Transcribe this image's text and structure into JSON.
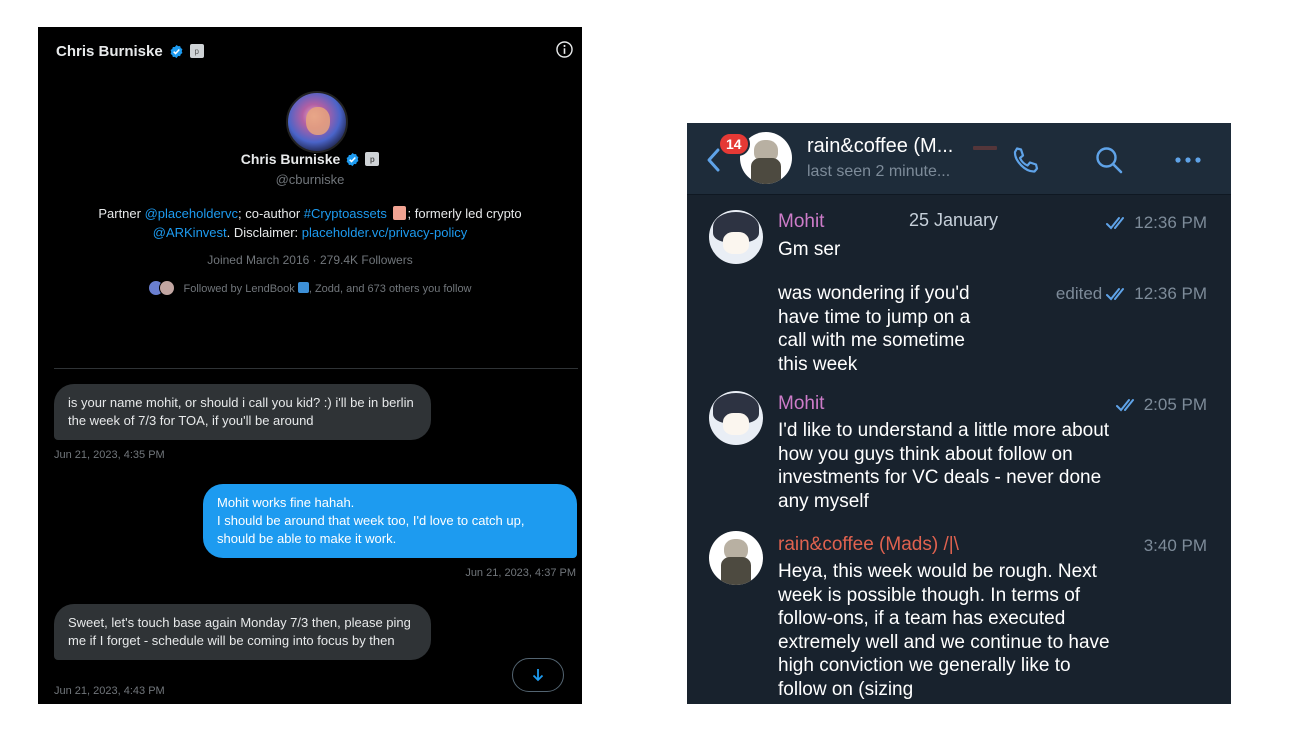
{
  "twitter": {
    "header_name": "Chris Burniske",
    "profile": {
      "name": "Chris Burniske",
      "handle": "@cburniske",
      "bio": {
        "t1": "Partner ",
        "l1": "@placeholdervc",
        "t2": "; co-author ",
        "l2": "#Cryptoassets",
        "t3": "; formerly led crypto",
        "l3": "@ARKinvest",
        "t4": ". Disclaimer: ",
        "l4": "placeholder.vc/privacy-policy"
      },
      "joined": "Joined March 2016 · 279.4K Followers",
      "followed_prefix": "Followed by LendBook",
      "followed_suffix": ", Zodd, and 673 others you follow"
    },
    "messages": [
      {
        "text": "is your name mohit, or should i call you kid? :) i'll be in berlin the week of 7/3 for TOA, if you'll be around",
        "time": "Jun 21, 2023, 4:35 PM"
      },
      {
        "text": "Mohit works fine hahah.\nI should be around that week too, I'd love to catch up, should be able to make it work.",
        "time": "Jun 21, 2023, 4:37 PM"
      },
      {
        "text": "Sweet, let's touch base again Monday 7/3 then, please ping me if I forget - schedule will be coming into focus by then",
        "time": "Jun 21, 2023, 4:43 PM"
      }
    ]
  },
  "telegram": {
    "header": {
      "unread_count": "14",
      "title": "rain&coffee (M...",
      "status": "last seen 2 minute..."
    },
    "date_label": "25 January",
    "messages": [
      {
        "sender": "Mohit",
        "text": "Gm ser",
        "edited": "",
        "time": "12:36 PM"
      },
      {
        "sender": "",
        "text": "was wondering if you'd have time to jump on a call with me sometime this week",
        "edited": "edited",
        "time": "12:36 PM"
      },
      {
        "sender": "Mohit",
        "text": "I'd like to understand a little more about how you guys think about follow on investments for VC deals - never done any myself",
        "edited": "",
        "time": "2:05 PM"
      },
      {
        "sender": "rain&coffee (Mads) /|\\",
        "text": "Heya, this week would be rough. Next week is possible though. In terms of follow-ons, if a team has executed extremely well and we continue to have high conviction we generally like to follow on (sizing",
        "edited": "",
        "time": "3:40 PM"
      }
    ],
    "colors": {
      "mohit": "#cd7cc9",
      "rain": "#e0624f",
      "accent": "#5fa3e8"
    }
  }
}
